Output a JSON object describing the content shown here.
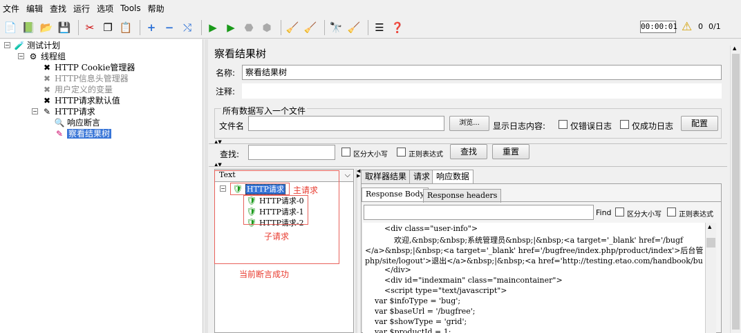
{
  "menu": [
    "文件",
    "编辑",
    "查找",
    "运行",
    "选项",
    "Tools",
    "帮助"
  ],
  "toolbar": {
    "timer": "00:00:01",
    "warnings": "0",
    "threads": "0/1"
  },
  "tree": {
    "root": "测试计划",
    "thread_group": "线程组",
    "cookie": "HTTP Cookie管理器",
    "header": "HTTP信息头管理器",
    "vars": "用户定义的变量",
    "defaults": "HTTP请求默认值",
    "request": "HTTP请求",
    "assert": "响应断言",
    "listener": "察看结果树"
  },
  "panel": {
    "title": "察看结果树",
    "name_label": "名称:",
    "name_value": "察看结果树",
    "comment_label": "注释:",
    "file_group": "所有数据写入一个文件",
    "file_label": "文件名",
    "browse": "浏览...",
    "log_label": "显示日志内容:",
    "errors_only": "仅错误日志",
    "success_only": "仅成功日志",
    "config": "配置",
    "search_label": "查找:",
    "case": "区分大小写",
    "regex": "正则表达式",
    "find_btn": "查找",
    "reset_btn": "重置"
  },
  "results": {
    "renderer": "Text",
    "main": "HTTP请求",
    "subs": [
      "HTTP请求-0",
      "HTTP请求-1",
      "HTTP请求-2"
    ],
    "ann_main": "主请求",
    "ann_sub": "子请求",
    "ann_assert": "当前断言成功"
  },
  "tabs": {
    "sampler": "取样器结果",
    "request": "请求",
    "response": "响应数据"
  },
  "subtabs": {
    "body": "Response Body",
    "headers": "Response headers"
  },
  "resp_search": {
    "find": "Find",
    "case": "区分大小写",
    "regex": "正则表达式"
  },
  "code": [
    "        <div class=\"user-info\">",
    "            欢迎,&nbsp;&nbsp;系统管理员&nbsp;|&nbsp;<a target='_blank' href='/bugf",
    "</a>&nbsp;|&nbsp;<a target='_blank' href='/bugfree/index.php/product/index'>后台管",
    "php/site/logout'>退出</a>&nbsp;|&nbsp;<a href='http://testing.etao.com/handbook/bu",
    "        </div>",
    "        <div id=\"indexmain\" class=\"maincontainer\">",
    "        <script type=\"text/javascript\">",
    "    var $infoType = 'bug';",
    "    var $baseUrl = '/bugfree';",
    "    var $showType = 'grid';",
    "    var $productId = 1;"
  ]
}
